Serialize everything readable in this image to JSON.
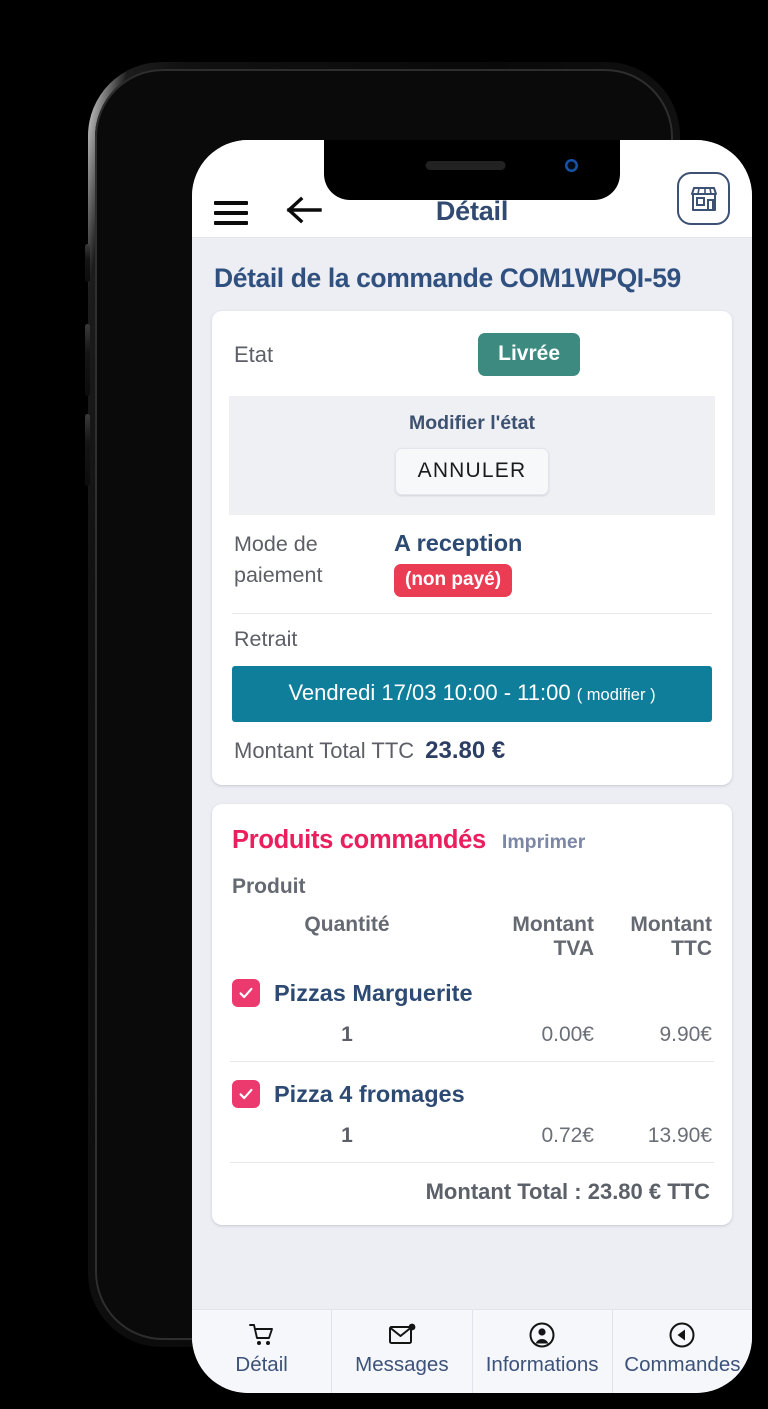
{
  "header": {
    "title": "Détail",
    "menu_icon": "hamburger-menu-icon",
    "back_icon": "back-arrow-icon",
    "shop_icon": "storefront-icon"
  },
  "page": {
    "title": "Détail de la commande COM1WPQI-59"
  },
  "order_card": {
    "etat_label": "Etat",
    "status": "Livrée",
    "status_color": "#3d8a80",
    "modify_title": "Modifier l'état",
    "cancel_button": "ANNULER",
    "payment_label": "Mode de paiement",
    "payment_value": "A reception",
    "payment_badge": "(non payé)",
    "payment_badge_color": "#ea3c52",
    "retrait_label": "Retrait",
    "slot_text": "Vendredi 17/03 10:00 - 11:00",
    "slot_modifier": "( modifier )",
    "slot_color": "#0f7e9b",
    "total_label": "Montant Total TTC",
    "total_value": "23.80 €"
  },
  "products_card": {
    "title": "Produits commandés",
    "title_color": "#ec1f5e",
    "print_link": "Imprimer",
    "col_produit": "Produit",
    "col_quantite": "Quantité",
    "col_tva_line1": "Montant",
    "col_tva_line2": "TVA",
    "col_ttc_line1": "Montant",
    "col_ttc_line2": "TTC",
    "items": [
      {
        "name": "Pizzas Marguerite",
        "checked": true,
        "quantity": "1",
        "tva": "0.00€",
        "ttc": "9.90€"
      },
      {
        "name": "Pizza 4 fromages",
        "checked": true,
        "quantity": "1",
        "tva": "0.72€",
        "ttc": "13.90€"
      }
    ],
    "grand_total": "Montant Total : 23.80 € TTC",
    "checkbox_color": "#ec3a6f"
  },
  "tabbar": {
    "items": [
      {
        "label": "Détail",
        "icon": "shopping-cart-icon"
      },
      {
        "label": "Messages",
        "icon": "envelope-notification-icon"
      },
      {
        "label": "Informations",
        "icon": "user-circle-icon"
      },
      {
        "label": "Commandes",
        "icon": "circle-play-back-icon"
      }
    ]
  }
}
